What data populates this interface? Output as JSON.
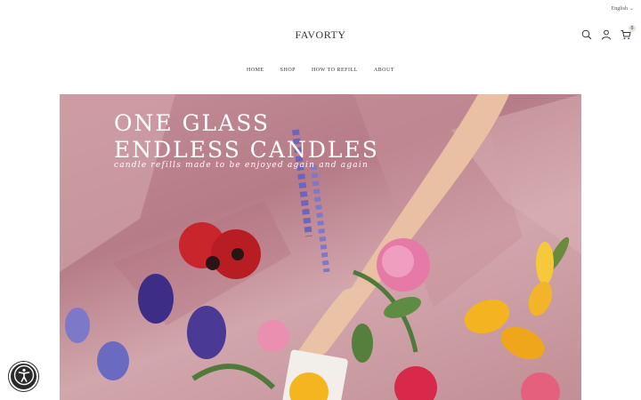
{
  "header": {
    "language": "English",
    "logo": "FAVORTY",
    "cart_count": "0",
    "icons": [
      "search-icon",
      "user-icon",
      "cart-icon",
      "chevron-down-icon"
    ]
  },
  "nav": {
    "items": [
      {
        "label": "HOME"
      },
      {
        "label": "SHOP"
      },
      {
        "label": "HOW TO REFILL"
      },
      {
        "label": "ABOUT"
      }
    ]
  },
  "hero": {
    "title_line1": "ONE GLASS",
    "title_line2": "ENDLESS CANDLES",
    "subtitle": "candle refills made to be enjoyed again and again"
  },
  "accessibility": {
    "icon": "accessibility-icon"
  }
}
